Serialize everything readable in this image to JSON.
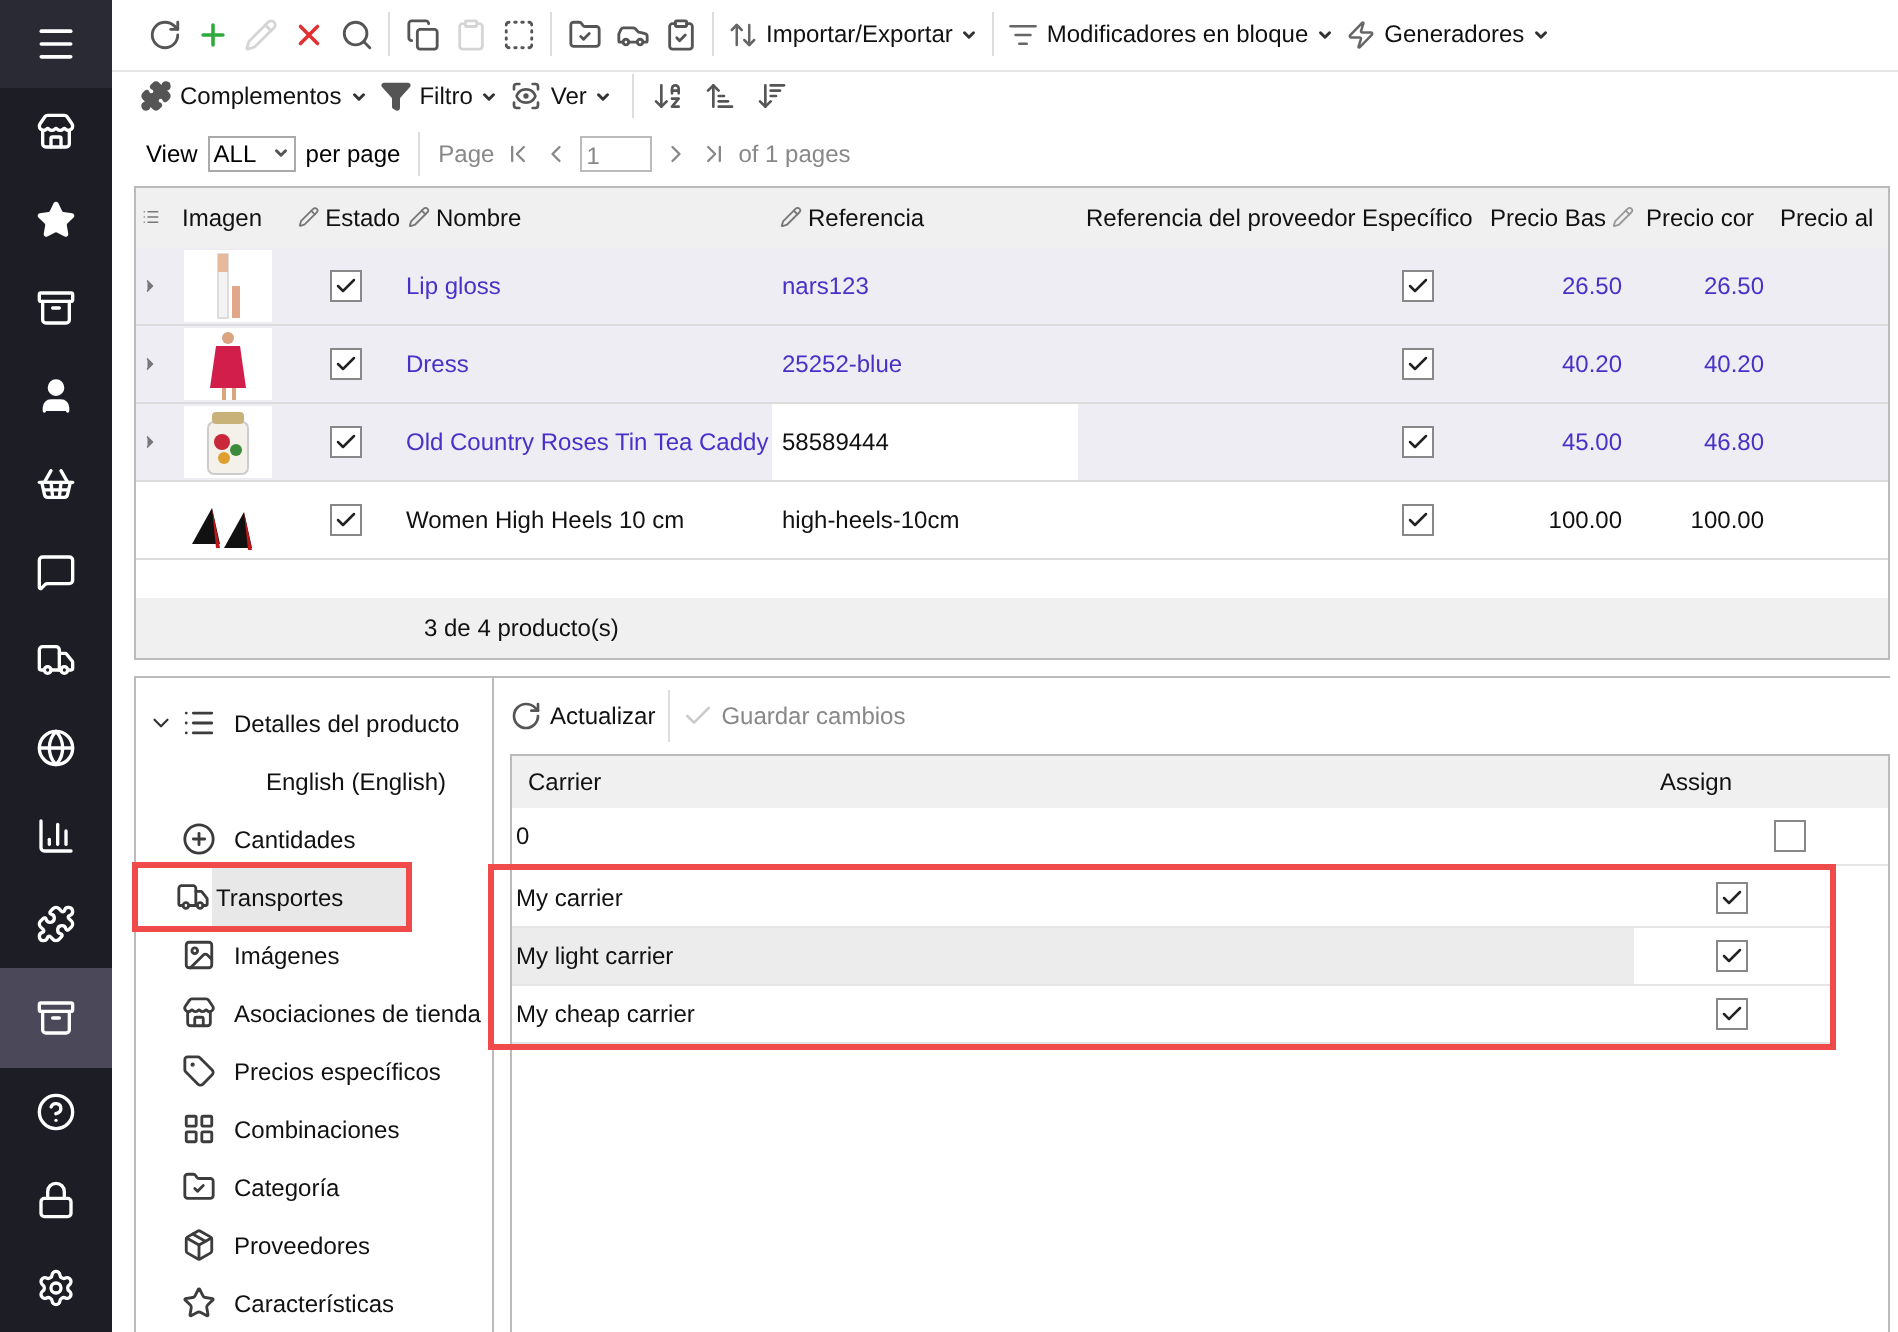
{
  "sidebar": {
    "items": [
      {
        "selected": false
      },
      {
        "selected": false
      },
      {
        "selected": false
      },
      {
        "selected": false
      },
      {
        "selected": false
      },
      {
        "selected": false
      },
      {
        "selected": false
      },
      {
        "selected": false
      },
      {
        "selected": false
      },
      {
        "selected": false
      },
      {
        "selected": true
      },
      {
        "selected": false
      },
      {
        "selected": false
      },
      {
        "selected": false
      }
    ]
  },
  "toolbar": {
    "icon_buttons": [
      {
        "disabled": false
      },
      {
        "disabled": false
      },
      {
        "disabled": true
      },
      {
        "disabled": false
      },
      {
        "disabled": false
      },
      {
        "disabled": false
      },
      {
        "disabled": true
      },
      {
        "disabled": false
      },
      {
        "disabled": false
      },
      {
        "disabled": false
      },
      {
        "disabled": false
      }
    ],
    "menus": [
      {
        "label": "Importar/Exportar"
      },
      {
        "label": "Modificadores en bloque"
      },
      {
        "label": "Generadores"
      }
    ],
    "menus_2": [
      {
        "label": "Complementos"
      },
      {
        "label": "Filtro"
      },
      {
        "label": "Ver"
      }
    ]
  },
  "pager": {
    "view_label": "View",
    "per_page_select": "ALL",
    "per_page_label": "per page",
    "page_label": "Page",
    "page_input": "1",
    "of_pages": "of 1 pages"
  },
  "grid": {
    "columns": [
      "Imagen",
      "Estado",
      "Nombre",
      "Referencia",
      "Referencia del proveedor",
      "Específico",
      "Precio Bas",
      "Precio cor",
      "Precio al"
    ],
    "rows": [
      {
        "modified": true,
        "expandable": true,
        "estado": true,
        "name": "Lip gloss",
        "reference": "nars123",
        "reference_focused": false,
        "especifico": true,
        "precio_base": "26.50",
        "precio_con": "26.50"
      },
      {
        "modified": true,
        "expandable": true,
        "estado": true,
        "name": "Dress",
        "reference": "25252-blue",
        "reference_focused": false,
        "especifico": true,
        "precio_base": "40.20",
        "precio_con": "40.20"
      },
      {
        "modified": true,
        "expandable": true,
        "estado": true,
        "name": "Old Country Roses Tin Tea Caddy",
        "reference": "58589444",
        "reference_focused": true,
        "especifico": true,
        "precio_base": "45.00",
        "precio_con": "46.80"
      },
      {
        "modified": false,
        "expandable": false,
        "estado": true,
        "name": "Women High Heels 10 cm",
        "reference": "high-heels-10cm",
        "reference_focused": false,
        "especifico": true,
        "precio_base": "100.00",
        "precio_con": "100.00"
      }
    ],
    "footer": "3 de 4 producto(s)"
  },
  "tree": [
    {
      "label": "Detalles del producto",
      "expanded": true,
      "selected": false,
      "highlighted": false,
      "children": [
        {
          "label": "English (English)"
        }
      ]
    },
    {
      "label": "Cantidades",
      "selected": false,
      "highlighted": false
    },
    {
      "label": "Transportes",
      "selected": true,
      "highlighted": true
    },
    {
      "label": "Imágenes",
      "selected": false,
      "highlighted": false
    },
    {
      "label": "Asociaciones de tienda",
      "selected": false,
      "highlighted": false
    },
    {
      "label": "Precios específicos",
      "selected": false,
      "highlighted": false
    },
    {
      "label": "Combinaciones",
      "selected": false,
      "highlighted": false
    },
    {
      "label": "Categoría",
      "selected": false,
      "highlighted": false
    },
    {
      "label": "Proveedores",
      "selected": false,
      "highlighted": false
    },
    {
      "label": "Características",
      "selected": false,
      "highlighted": false
    }
  ],
  "carriers": {
    "refresh_button": "Actualizar",
    "save_button": {
      "label": "Guardar cambios",
      "disabled": true
    },
    "columns": [
      "Carrier",
      "Assign"
    ],
    "rows": [
      {
        "carrier": "0",
        "assigned": false,
        "selected": false,
        "highlighted": false
      },
      {
        "carrier": "My carrier",
        "assigned": true,
        "selected": false,
        "highlighted": true
      },
      {
        "carrier": "My light carrier",
        "assigned": true,
        "selected": true,
        "highlighted": true
      },
      {
        "carrier": "My cheap carrier",
        "assigned": true,
        "selected": false,
        "highlighted": true
      }
    ]
  }
}
